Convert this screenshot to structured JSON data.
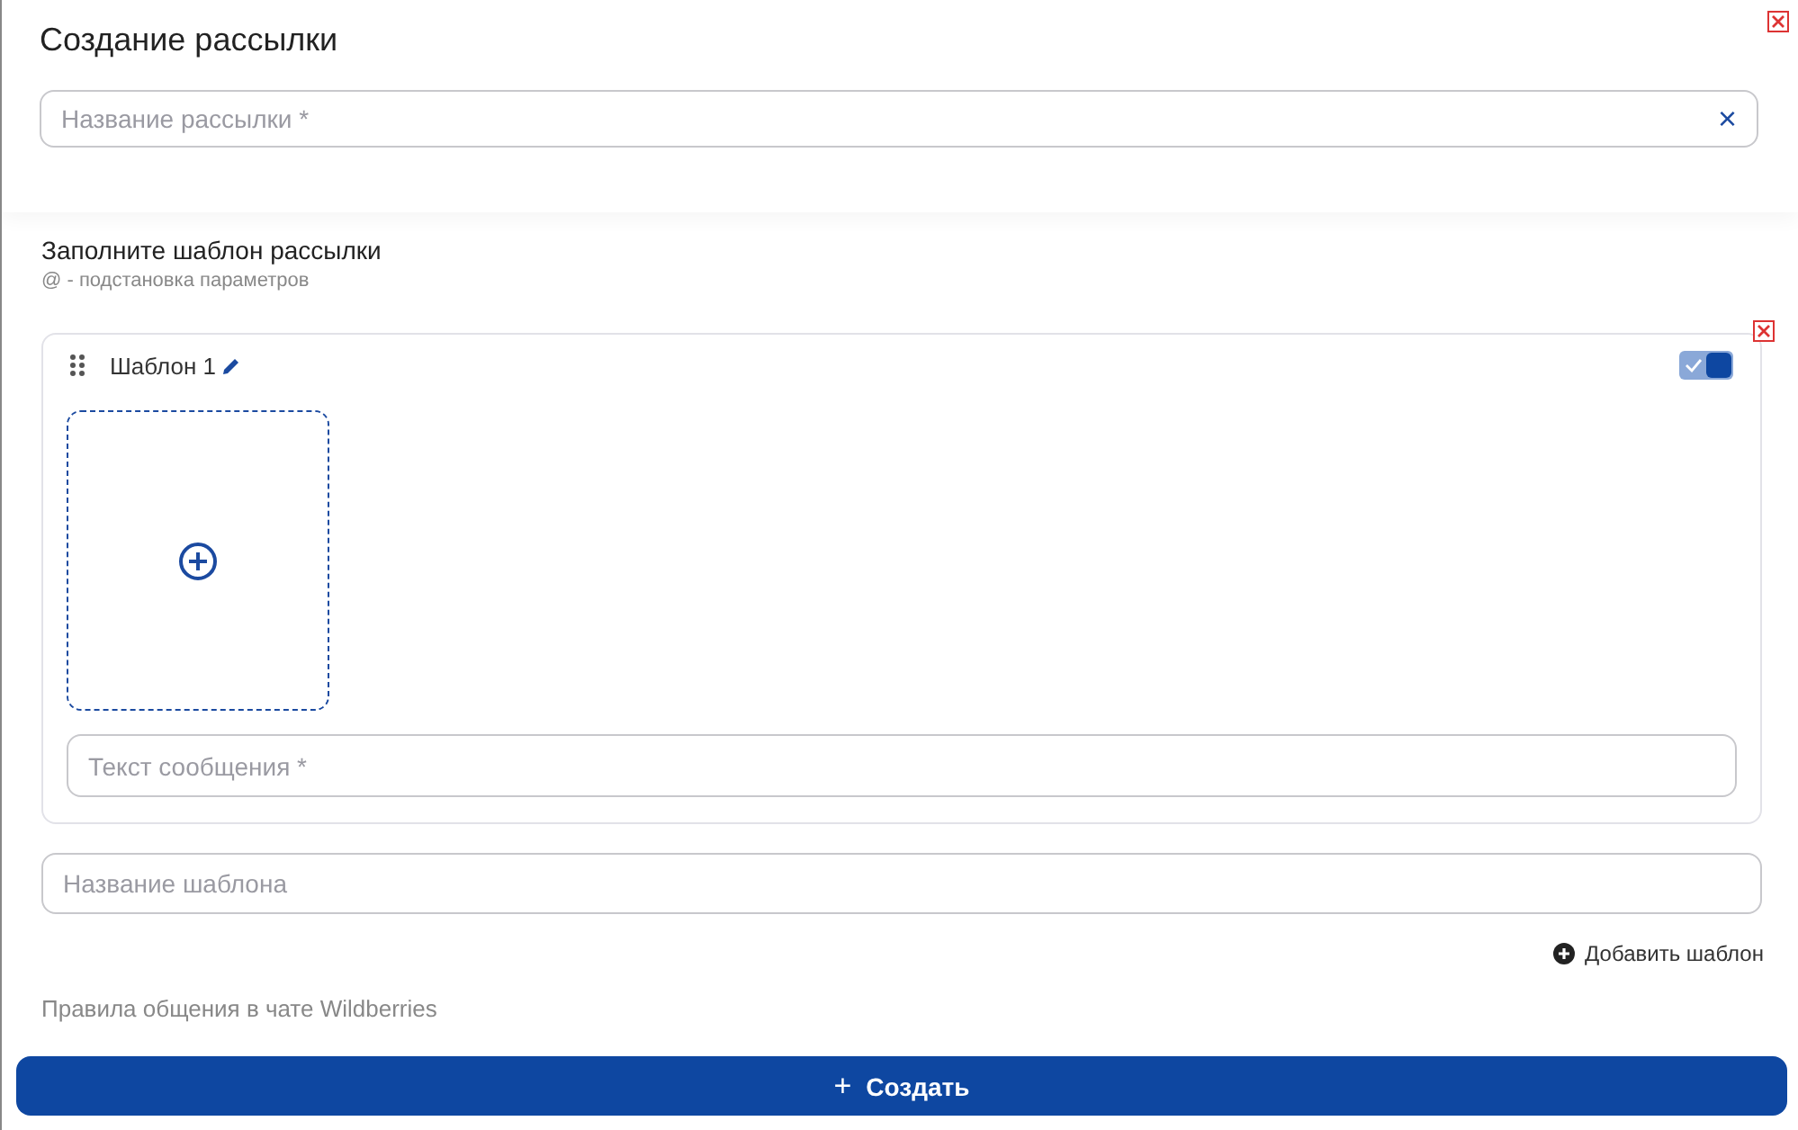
{
  "dialog": {
    "title": "Создание рассылки"
  },
  "mailing_name": {
    "placeholder": "Название рассылки *",
    "clear": "×"
  },
  "template_section": {
    "title": "Заполните шаблон рассылки",
    "hint": "@ - подстановка параметров"
  },
  "templates": [
    {
      "name": "Шаблон 1",
      "enabled": true,
      "message": {
        "placeholder": "Текст сообщения *"
      }
    }
  ],
  "template_name": {
    "placeholder": "Название шаблона"
  },
  "add_template": "Добавить шаблон",
  "rules_link": "Правила общения в чате Wildberries",
  "create_button": {
    "icon": "+",
    "label": "Создать"
  }
}
